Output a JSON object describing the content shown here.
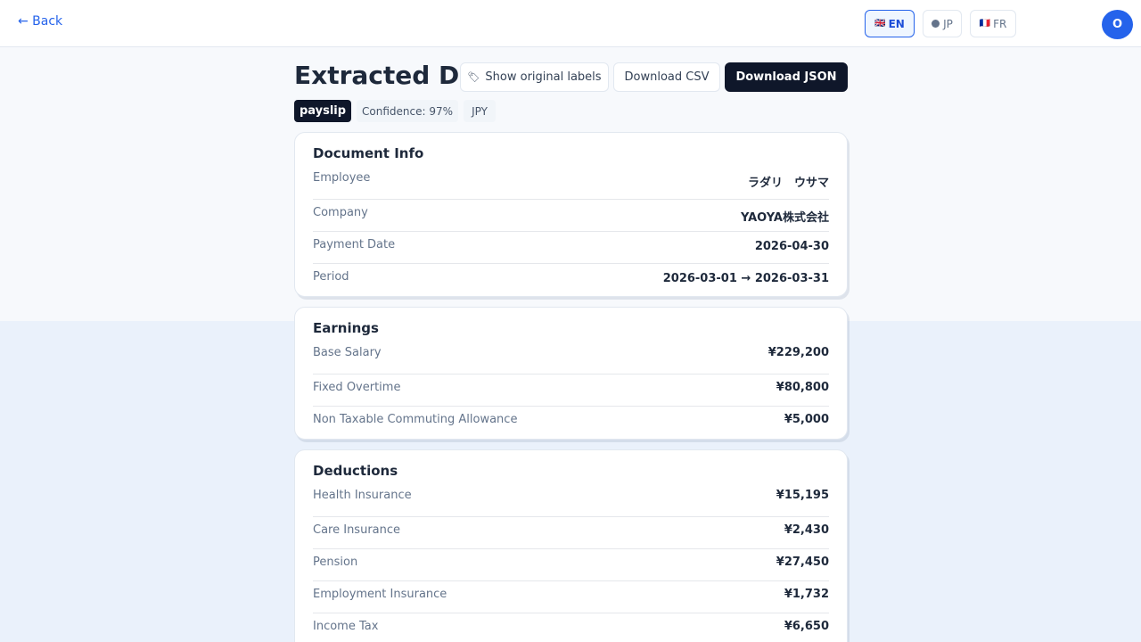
{
  "header": {
    "back_label": "← Back",
    "languages": [
      {
        "flag": "🇬🇧",
        "label": "EN"
      },
      {
        "label": "JP"
      },
      {
        "flag": "🇫🇷",
        "label": "FR"
      }
    ],
    "avatar_initial": "O"
  },
  "page": {
    "title": "Extracted Data",
    "show_labels_button": "Show original labels",
    "download_csv_button": "Download CSV",
    "download_json_button": "Download JSON",
    "doc_type": "payslip",
    "confidence": "Confidence: 97%",
    "currency": "JPY"
  },
  "sections": [
    {
      "title": "Document Info",
      "rows": [
        {
          "key": "Employee",
          "value": "ラダリ　ウサマ"
        },
        {
          "key": "Company",
          "value": "YAOYA株式会社"
        },
        {
          "key": "Payment Date",
          "value": "2026-04-30"
        },
        {
          "key": "Period",
          "value": "2026-03-01 → 2026-03-31"
        }
      ]
    },
    {
      "title": "Earnings",
      "rows": [
        {
          "key": "Base Salary",
          "value": "¥229,200"
        },
        {
          "key": "Fixed Overtime",
          "value": "¥80,800"
        },
        {
          "key": "Non Taxable Commuting Allowance",
          "value": "¥5,000"
        }
      ]
    },
    {
      "title": "Deductions",
      "rows": [
        {
          "key": "Health Insurance",
          "value": "¥15,195"
        },
        {
          "key": "Care Insurance",
          "value": "¥2,430"
        },
        {
          "key": "Pension",
          "value": "¥27,450"
        },
        {
          "key": "Employment Insurance",
          "value": "¥1,732"
        },
        {
          "key": "Income Tax",
          "value": "¥6,650"
        }
      ]
    }
  ]
}
